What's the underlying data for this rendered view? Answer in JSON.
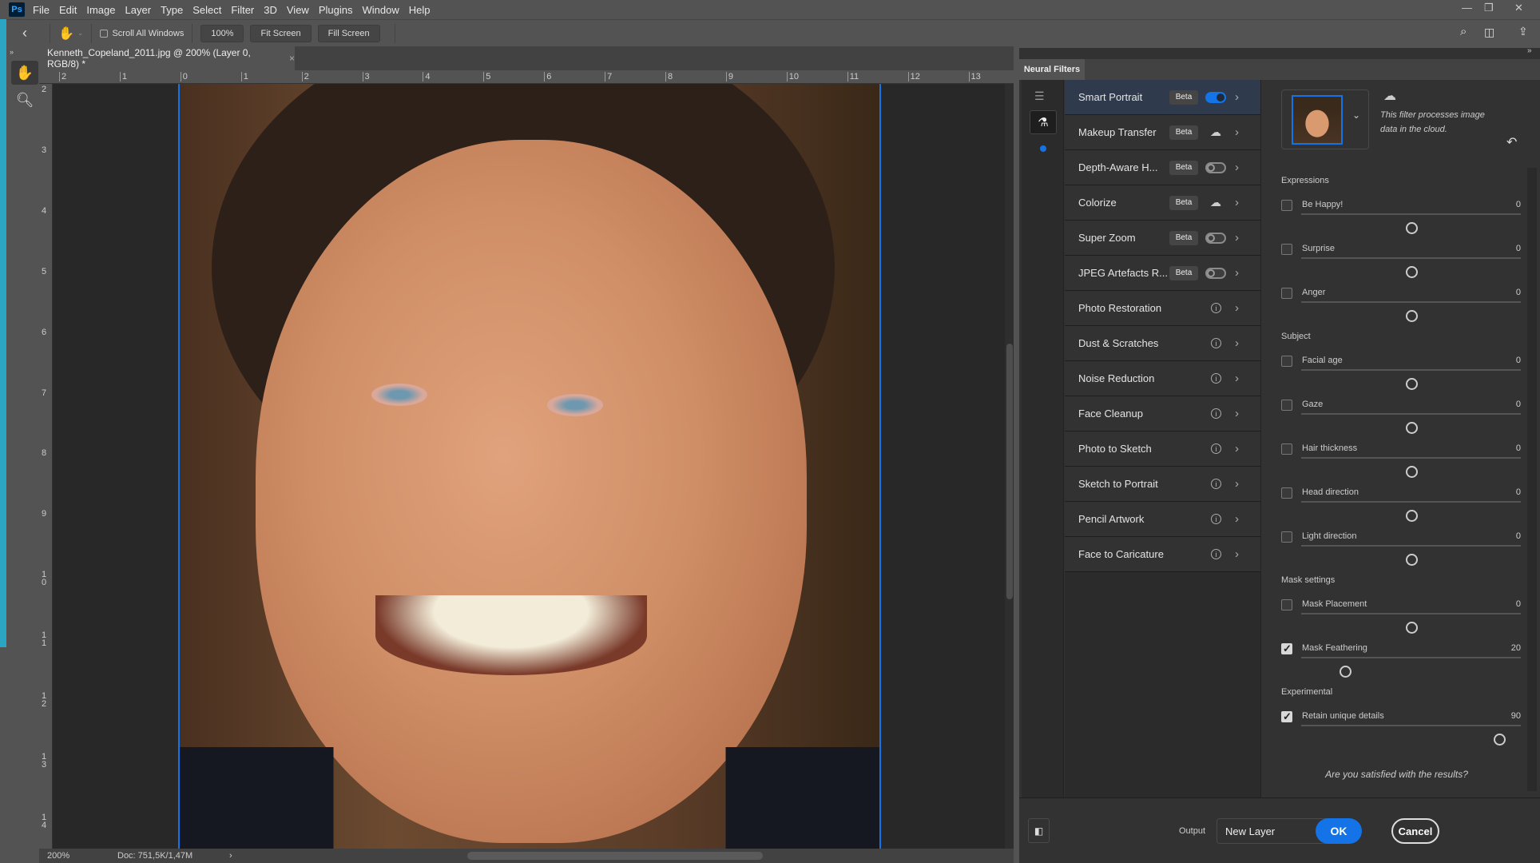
{
  "app": {
    "logo": "Ps",
    "menu": [
      "File",
      "Edit",
      "Image",
      "Layer",
      "Type",
      "Select",
      "Filter",
      "3D",
      "View",
      "Plugins",
      "Window",
      "Help"
    ]
  },
  "options": {
    "scroll_all": "Scroll All Windows",
    "zoom100": "100%",
    "fit": "Fit Screen",
    "fill": "Fill Screen"
  },
  "document": {
    "tab_title": "Kenneth_Copeland_2011.jpg @ 200% (Layer 0, RGB/8) *",
    "zoom": "200%",
    "doc_info": "Doc: 751,5K/1,47M",
    "hruler": [
      "2",
      "1",
      "0",
      "1",
      "2",
      "3",
      "4",
      "5",
      "6",
      "7",
      "8",
      "9",
      "10",
      "11",
      "12",
      "13"
    ],
    "vruler": [
      "2",
      "3",
      "4",
      "5",
      "6",
      "7",
      "8",
      "9",
      "10",
      "11",
      "12",
      "13",
      "14"
    ]
  },
  "neural_filters": {
    "tab": "Neural Filters",
    "filters": [
      {
        "name": "Smart Portrait",
        "beta": "Beta",
        "control": "toggle",
        "on": true,
        "active": true
      },
      {
        "name": "Makeup Transfer",
        "beta": "Beta",
        "control": "cloud"
      },
      {
        "name": "Depth-Aware H...",
        "beta": "Beta",
        "control": "toggle",
        "on": false
      },
      {
        "name": "Colorize",
        "beta": "Beta",
        "control": "cloud"
      },
      {
        "name": "Super Zoom",
        "beta": "Beta",
        "control": "toggle",
        "on": false
      },
      {
        "name": "JPEG Artefacts R...",
        "beta": "Beta",
        "control": "toggle",
        "on": false
      },
      {
        "name": "Photo Restoration",
        "control": "info"
      },
      {
        "name": "Dust & Scratches",
        "control": "info"
      },
      {
        "name": "Noise Reduction",
        "control": "info"
      },
      {
        "name": "Face Cleanup",
        "control": "info"
      },
      {
        "name": "Photo to Sketch",
        "control": "info"
      },
      {
        "name": "Sketch to Portrait",
        "control": "info"
      },
      {
        "name": "Pencil Artwork",
        "control": "info"
      },
      {
        "name": "Face to Caricature",
        "control": "info"
      }
    ],
    "cloud_note": "This filter processes image data in the cloud.",
    "sections": [
      {
        "title": "Expressions",
        "items": [
          {
            "label": "Be Happy!",
            "value": "0",
            "checked": false,
            "min": -50,
            "max": 50
          },
          {
            "label": "Surprise",
            "value": "0",
            "checked": false,
            "min": -50,
            "max": 50
          },
          {
            "label": "Anger",
            "value": "0",
            "checked": false,
            "min": -50,
            "max": 50
          }
        ]
      },
      {
        "title": "Subject",
        "items": [
          {
            "label": "Facial age",
            "value": "0",
            "checked": false,
            "min": -50,
            "max": 50
          },
          {
            "label": "Gaze",
            "value": "0",
            "checked": false,
            "min": -50,
            "max": 50
          },
          {
            "label": "Hair thickness",
            "value": "0",
            "checked": false,
            "min": -50,
            "max": 50
          },
          {
            "label": "Head direction",
            "value": "0",
            "checked": false,
            "min": -50,
            "max": 50
          },
          {
            "label": "Light direction",
            "value": "0",
            "checked": false,
            "min": -50,
            "max": 50
          }
        ]
      },
      {
        "title": "Mask settings",
        "items": [
          {
            "label": "Mask Placement",
            "value": "0",
            "checked": false,
            "min": -50,
            "max": 50
          },
          {
            "label": "Mask Feathering",
            "value": "20",
            "checked": true,
            "min": 0,
            "max": 100
          }
        ]
      },
      {
        "title": "Experimental",
        "items": [
          {
            "label": "Retain unique details",
            "value": "90",
            "checked": true,
            "min": 0,
            "max": 100
          }
        ]
      }
    ],
    "satisfied": "Are you satisfied with the results?",
    "output_label": "Output",
    "output_value": "New Layer",
    "ok": "OK",
    "cancel": "Cancel"
  },
  "colors": {
    "accent": "#1473e6",
    "cyan_strip": "#2aa6c4"
  }
}
